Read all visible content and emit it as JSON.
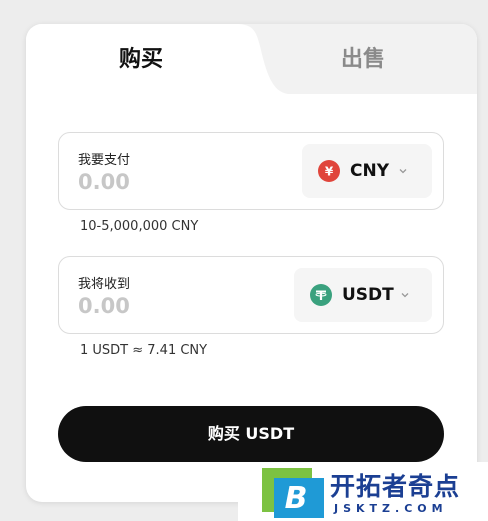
{
  "tabs": {
    "buy": "购买",
    "sell": "出售"
  },
  "pay": {
    "label": "我要支付",
    "placeholder": "0.00",
    "currency": "CNY",
    "currency_symbol": "¥",
    "hint": "10-5,000,000 CNY"
  },
  "receive": {
    "label": "我将收到",
    "placeholder": "0.00",
    "currency": "USDT",
    "currency_symbol": "₮",
    "hint": "1 USDT ≈ 7.41 CNY"
  },
  "buy_button": "购买 USDT",
  "watermark": {
    "text": "开拓者奇点",
    "sub": "JSKTZ.COM",
    "logo_letter": "B"
  },
  "colors": {
    "cny_icon": "#e0453b",
    "usdt_icon": "#3aa17e",
    "button": "#101010"
  }
}
